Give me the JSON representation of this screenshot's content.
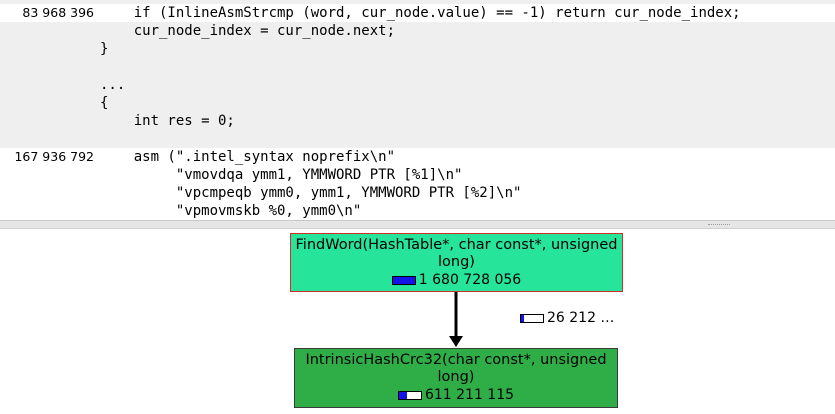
{
  "code": {
    "lines": [
      {
        "cost": "83 968 396",
        "text": "    if (InlineAsmStrcmp (word, cur_node.value) == -1) return cur_node_index;",
        "highlight": true
      },
      {
        "cost": "",
        "text": "    cur_node_index = cur_node.next;",
        "highlight": false
      },
      {
        "cost": "",
        "text": "}",
        "highlight": false
      },
      {
        "cost": "",
        "text": "",
        "highlight": false
      },
      {
        "cost": "",
        "text": "...",
        "highlight": false
      },
      {
        "cost": "",
        "text": "{",
        "highlight": false
      },
      {
        "cost": "",
        "text": "    int res = 0;",
        "highlight": false
      },
      {
        "cost": "",
        "text": "",
        "highlight": false
      },
      {
        "cost": "167 936 792",
        "text": "    asm (\".intel_syntax noprefix\\n\"",
        "highlight": true
      },
      {
        "cost": "",
        "text": "         \"vmovdqa ymm1, YMMWORD PTR [%1]\\n\"",
        "highlight": true
      },
      {
        "cost": "",
        "text": "         \"vpcmpeqb ymm0, ymm1, YMMWORD PTR [%2]\\n\"",
        "highlight": true
      },
      {
        "cost": "",
        "text": "         \"vpmovmskb %0, ymm0\\n\"",
        "highlight": true
      }
    ]
  },
  "graph": {
    "caller": {
      "name": "FindWord(HashTable*, char const*, unsigned long)",
      "cost": "1 680 728 056",
      "bar_fraction": 1.0,
      "fill_color": "#26e59a",
      "border_color": "#d12b2b"
    },
    "callee": {
      "name": "IntrinsicHashCrc32(char const*, unsigned long)",
      "cost": "611 211 115",
      "bar_fraction": 0.36,
      "fill_color": "#2fae48"
    },
    "edge": {
      "calls": "26 212 …",
      "bar_fraction": 0.15
    },
    "bar_color": "#1414e6"
  }
}
